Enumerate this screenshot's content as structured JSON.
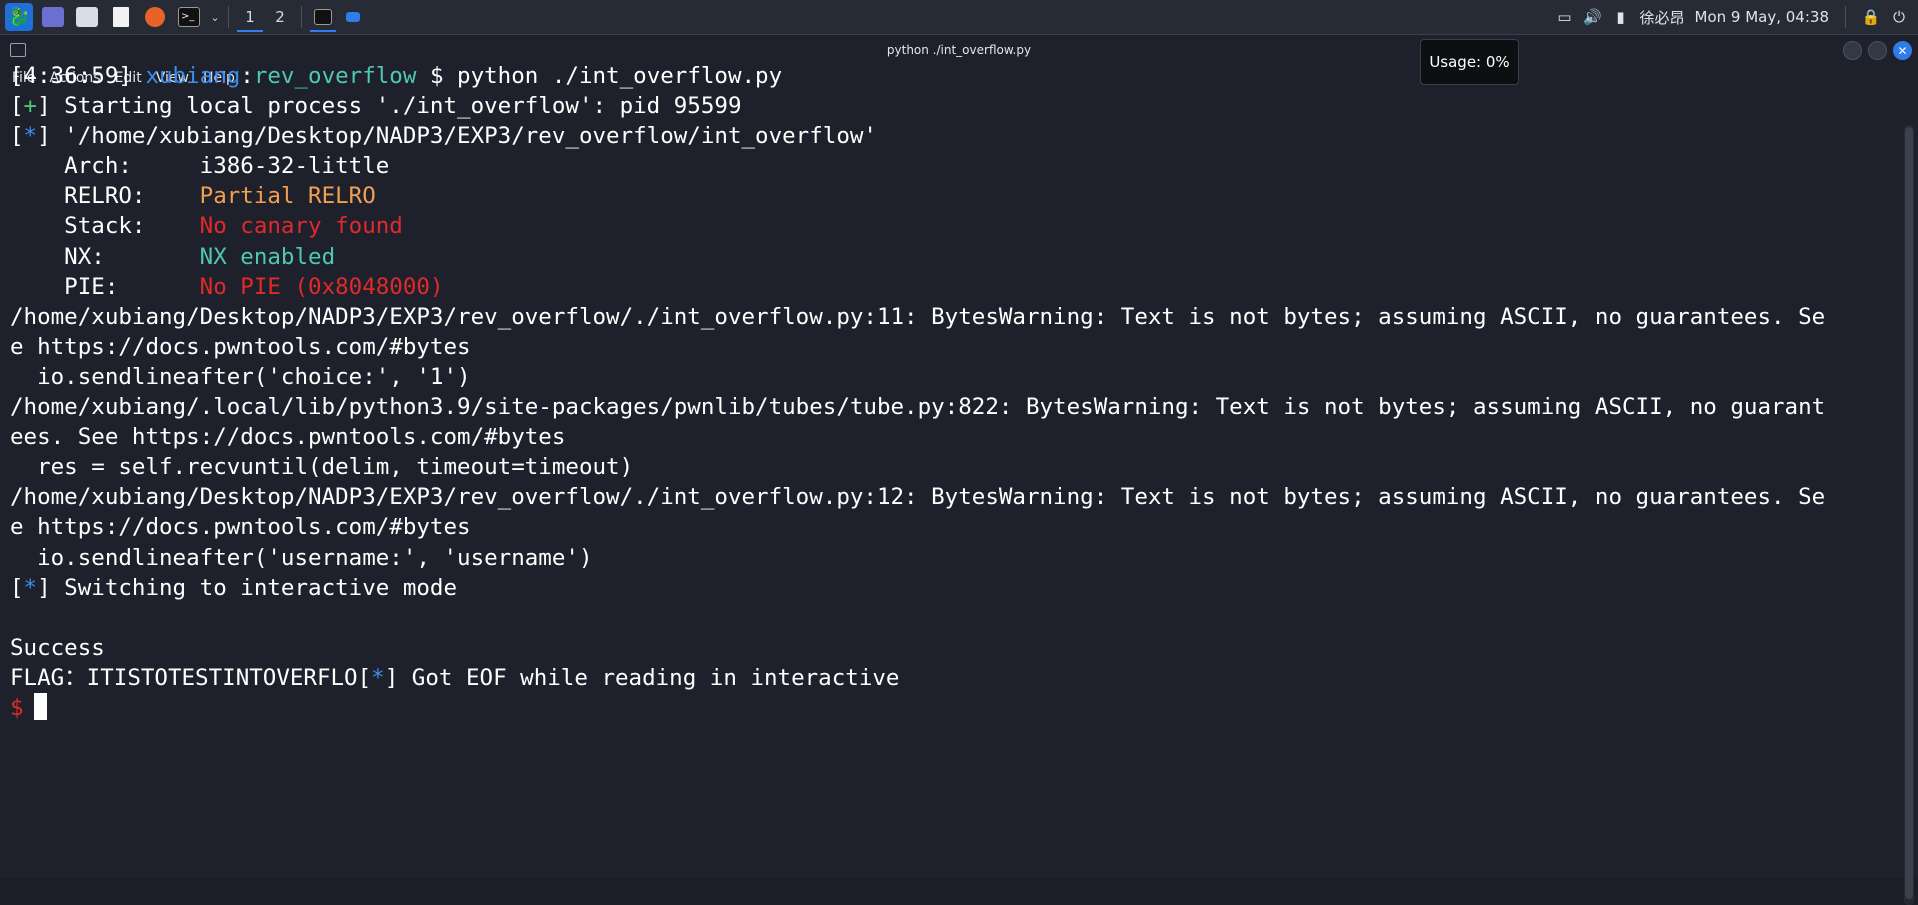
{
  "panel": {
    "workspaces": [
      "1",
      "2"
    ],
    "tray": {
      "username": "徐必昂",
      "datetime": "Mon 9 May, 04:38"
    }
  },
  "window": {
    "title": "python ./int_overflow.py",
    "menu": [
      "File",
      "Actions",
      "Edit",
      "View",
      "Help"
    ]
  },
  "tooltip": "Usage: 0%",
  "terminal": {
    "lines": [
      [
        {
          "t": "[4:36:59] ",
          "c": ""
        },
        {
          "t": "xubiang",
          "c": "c-blue"
        },
        {
          "t": ":",
          "c": ""
        },
        {
          "t": "rev_overflow",
          "c": "c-teal"
        },
        {
          "t": " $ python ./int_overflow.py",
          "c": ""
        }
      ],
      [
        {
          "t": "[",
          "c": ""
        },
        {
          "t": "+",
          "c": "c-green"
        },
        {
          "t": "] Starting local process './int_overflow': pid 95599",
          "c": ""
        }
      ],
      [
        {
          "t": "[",
          "c": ""
        },
        {
          "t": "*",
          "c": "c-blue"
        },
        {
          "t": "] '/home/xubiang/Desktop/NADP3/EXP3/rev_overflow/int_overflow'",
          "c": ""
        }
      ],
      [
        {
          "t": "    Arch:     i386-32-little",
          "c": ""
        }
      ],
      [
        {
          "t": "    RELRO:    ",
          "c": ""
        },
        {
          "t": "Partial RELRO",
          "c": "c-orange"
        }
      ],
      [
        {
          "t": "    Stack:    ",
          "c": ""
        },
        {
          "t": "No canary found",
          "c": "c-red"
        }
      ],
      [
        {
          "t": "    NX:       ",
          "c": ""
        },
        {
          "t": "NX enabled",
          "c": "c-teal"
        }
      ],
      [
        {
          "t": "    PIE:      ",
          "c": ""
        },
        {
          "t": "No PIE (0x8048000)",
          "c": "c-red"
        }
      ],
      [
        {
          "t": "/home/xubiang/Desktop/NADP3/EXP3/rev_overflow/./int_overflow.py:11: BytesWarning: Text is not bytes; assuming ASCII, no guarantees. Se",
          "c": ""
        }
      ],
      [
        {
          "t": "e https://docs.pwntools.com/#bytes",
          "c": ""
        }
      ],
      [
        {
          "t": "  io.sendlineafter('choice:', '1')",
          "c": ""
        }
      ],
      [
        {
          "t": "/home/xubiang/.local/lib/python3.9/site-packages/pwnlib/tubes/tube.py:822: BytesWarning: Text is not bytes; assuming ASCII, no guarant",
          "c": ""
        }
      ],
      [
        {
          "t": "ees. See https://docs.pwntools.com/#bytes",
          "c": ""
        }
      ],
      [
        {
          "t": "  res = self.recvuntil(delim, timeout=timeout)",
          "c": ""
        }
      ],
      [
        {
          "t": "/home/xubiang/Desktop/NADP3/EXP3/rev_overflow/./int_overflow.py:12: BytesWarning: Text is not bytes; assuming ASCII, no guarantees. Se",
          "c": ""
        }
      ],
      [
        {
          "t": "e https://docs.pwntools.com/#bytes",
          "c": ""
        }
      ],
      [
        {
          "t": "  io.sendlineafter('username:', 'username')",
          "c": ""
        }
      ],
      [
        {
          "t": "[",
          "c": ""
        },
        {
          "t": "*",
          "c": "c-blue"
        },
        {
          "t": "] Switching to interactive mode",
          "c": ""
        }
      ],
      [
        {
          "t": "",
          "c": ""
        }
      ],
      [
        {
          "t": "Success",
          "c": ""
        }
      ],
      [
        {
          "t": "FLAG：ITISTOTESTINTOVERFLO[",
          "c": ""
        },
        {
          "t": "*",
          "c": "c-blue"
        },
        {
          "t": "] Got EOF while reading in interactive",
          "c": ""
        }
      ]
    ],
    "prompt": "$"
  },
  "colors": {
    "accent": "#367bf0",
    "background": "#1e212b",
    "prompt_red": "#e02a2a"
  },
  "icons": [
    "kali-menu-icon",
    "workspace-icon",
    "file-manager-icon",
    "text-editor-icon",
    "firefox-icon",
    "terminal-icon",
    "screen-icon",
    "volume-icon",
    "battery-icon",
    "lock-icon",
    "power-icon"
  ]
}
